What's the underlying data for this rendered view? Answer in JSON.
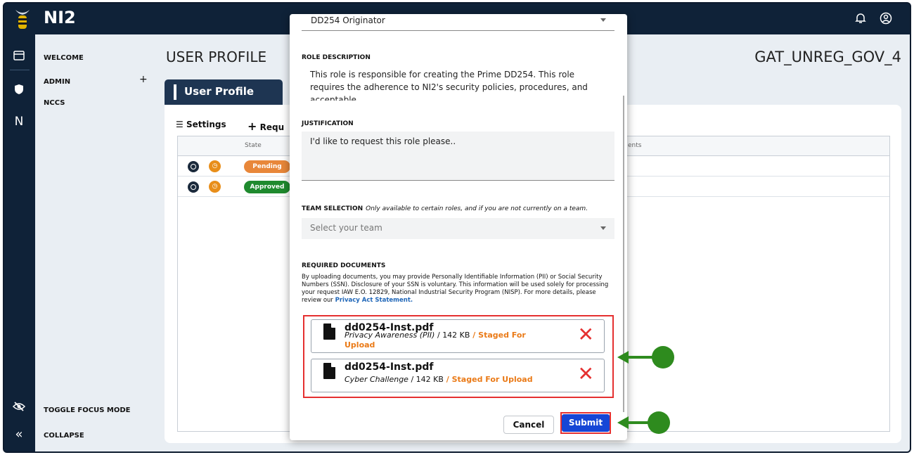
{
  "app": {
    "title": "NI2"
  },
  "topbar": {
    "bell_icon": "bell-icon",
    "account_icon": "account-circle-icon"
  },
  "rail": {
    "icons": [
      "dashboard-icon",
      "shield-icon",
      "n-icon",
      "eye-slash-icon",
      "chevrons-left-icon"
    ],
    "n_label": "N"
  },
  "sidebar": {
    "welcome": "WELCOME",
    "admin": "ADMIN",
    "admin_expand": "+",
    "nccs": "NCCS",
    "toggle_focus": "TOGGLE FOCUS MODE",
    "collapse": "COLLAPSE"
  },
  "main": {
    "page_title": "USER PROFILE",
    "user_id": "GAT_UNREG_GOV_4",
    "tab_label": "User Profile",
    "settings_label": "Settings",
    "request_label": "Requ",
    "columns": [
      "State",
      "ents"
    ],
    "rows": [
      {
        "state": "Pending",
        "color": "#e8873a"
      },
      {
        "state": "Approved",
        "color": "#1f8a2e"
      }
    ]
  },
  "modal": {
    "role_select_value": "DD254 Originator",
    "role_description_label": "ROLE DESCRIPTION",
    "role_description": "This role is responsible for creating the Prime DD254. This role requires the adherence to NI2's security policies, procedures, and acceptable",
    "justification_label": "JUSTIFICATION",
    "justification_value": "I'd like to request this role please..",
    "team_label": "TEAM SELECTION",
    "team_hint": "Only available to certain roles, and if you are not currently on a team.",
    "team_placeholder": "Select your team",
    "docs_label": "REQUIRED DOCUMENTS",
    "docs_info": "By uploading documents, you may provide Personally Identifiable Information (PII) or Social Security Numbers (SSN). Disclosure of your SSN is voluntary. This information will be used solely for processing your request IAW E.O. 12829, National Industrial Security Program (NISP). For more details, please review our",
    "privacy_link": "Privacy Act Statement.",
    "documents": [
      {
        "name": "dd0254-Inst.pdf",
        "type": "Privacy Awareness (PII)",
        "size": "142 KB",
        "status": "Staged For Upload"
      },
      {
        "name": "dd0254-Inst.pdf",
        "type": "Cyber Challenge",
        "size": "142 KB",
        "status": "Staged For Upload"
      }
    ],
    "separator": " / ",
    "cancel_label": "Cancel",
    "submit_label": "Submit"
  },
  "accent_colors": {
    "submit": "#1646d6",
    "highlight": "#e53030",
    "annotation_arrow": "#2e8b1e",
    "staged": "#ea7a17"
  }
}
